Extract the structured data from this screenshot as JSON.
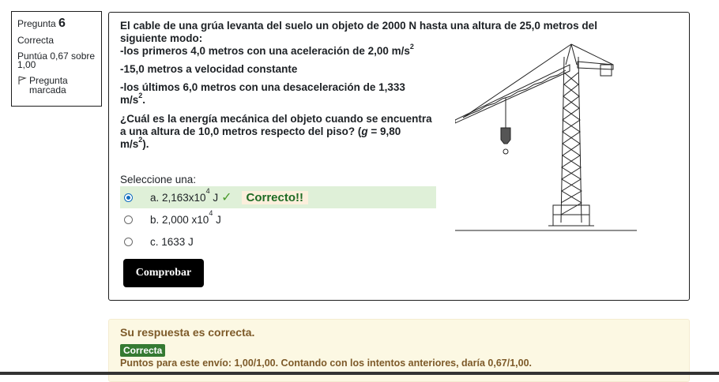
{
  "info": {
    "question_label": "Pregunta",
    "question_number": "6",
    "state": "Correcta",
    "grade": "Puntúa 0,67 sobre 1,00",
    "flag_label": "Pregunta marcada"
  },
  "question": {
    "intro": "El cable de una grúa levanta del suelo un objeto de 2000 N hasta una altura de 25,0 metros del siguiente modo:",
    "step1": "-los primeros 4,0 metros con una aceleración de 2,00 m/s",
    "step1_sup": "2",
    "step2": "-15,0 metros a velocidad constante",
    "step3": "-los últimos 6,0 metros con una desaceleración de 1,333 m/s",
    "step3_sup": "2",
    "step3_end": ".",
    "ask_a": "¿Cuál es la energía mecánica del objeto cuando se encuentra a una altura de 10,0 metros respecto del piso? (",
    "ask_g": "g",
    "ask_b": " = 9,80 m/s",
    "ask_sup": "2",
    "ask_c": ").",
    "prompt": "Seleccione una:",
    "options": [
      {
        "text": "a. 2,163x10",
        "sup": "4",
        "unit": " J",
        "selected": true
      },
      {
        "text": "b. 2,000 x10",
        "sup": "4",
        "unit": " J",
        "selected": false
      },
      {
        "text": "c. 1633 J",
        "sup": "",
        "unit": "",
        "selected": false
      }
    ],
    "correct_mark": "Correcto!!",
    "check_button": "Comprobar"
  },
  "feedback": {
    "message": "Su respuesta es correcta.",
    "badge": "Correcta",
    "points": "Puntos para este envío: 1,00/1,00. Contando con los intentos anteriores, daría 0,67/1,00."
  },
  "colors": {
    "selected_bg": "#dff0d8",
    "correct_green": "#357a32",
    "feedback_bg": "#fcf8e3",
    "feedback_text": "#7d5a29"
  }
}
